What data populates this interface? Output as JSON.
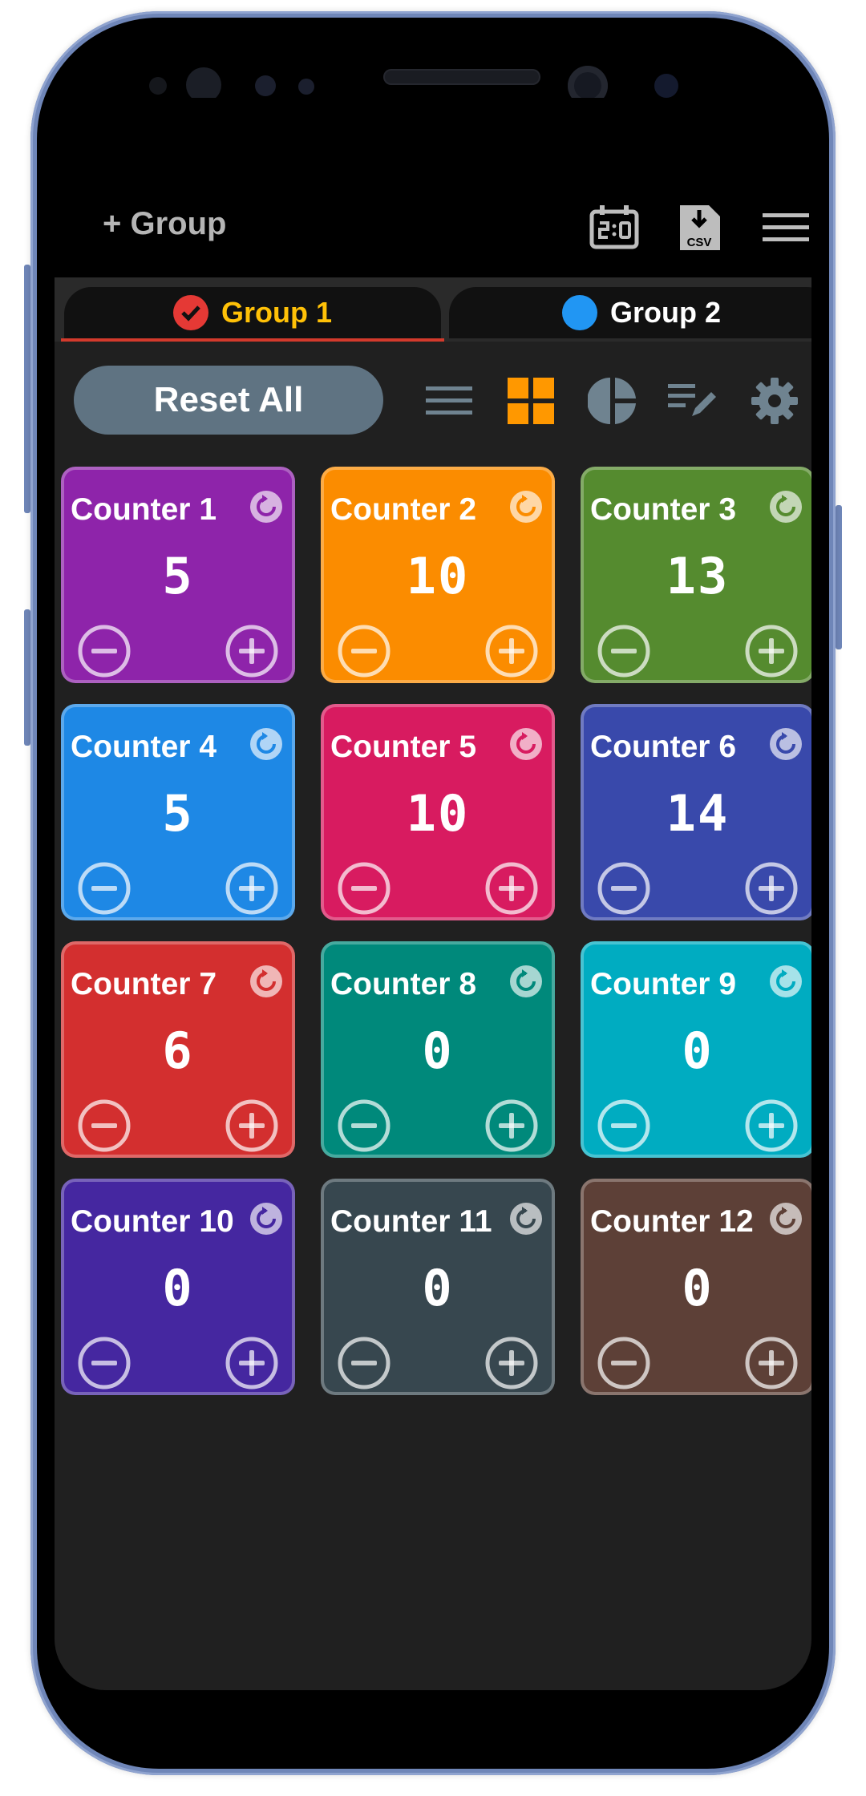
{
  "appbar": {
    "add_group_label": "+ Group",
    "icons": [
      "scoreboard-icon",
      "export-csv-icon",
      "menu-icon"
    ],
    "csv_text": "CSV"
  },
  "tabs": [
    {
      "label": "Group 1",
      "selected": true,
      "dot_color": "#e53935",
      "text_color": "#ffc107"
    },
    {
      "label": "Group 2",
      "selected": false,
      "dot_color": "#2196f3",
      "text_color": "#ffffff"
    }
  ],
  "toolbar": {
    "reset_all_label": "Reset All",
    "icons": [
      "list-view-icon",
      "grid-view-icon",
      "pie-chart-icon",
      "edit-list-icon",
      "settings-icon"
    ],
    "active_icon": "grid-view-icon",
    "accent_color": "#ff9800"
  },
  "counters": [
    {
      "name": "Counter 1",
      "value": "5",
      "color": "#8e24aa"
    },
    {
      "name": "Counter 2",
      "value": "10",
      "color": "#fb8c00"
    },
    {
      "name": "Counter 3",
      "value": "13",
      "color": "#558b2f"
    },
    {
      "name": "Counter 4",
      "value": "5",
      "color": "#1e88e5"
    },
    {
      "name": "Counter 5",
      "value": "10",
      "color": "#d81b60"
    },
    {
      "name": "Counter 6",
      "value": "14",
      "color": "#3949ab"
    },
    {
      "name": "Counter 7",
      "value": "6",
      "color": "#d32f2f"
    },
    {
      "name": "Counter 8",
      "value": "0",
      "color": "#00897b"
    },
    {
      "name": "Counter 9",
      "value": "0",
      "color": "#00acc1"
    },
    {
      "name": "Counter 10",
      "value": "0",
      "color": "#4527a0"
    },
    {
      "name": "Counter 11",
      "value": "0",
      "color": "#37474f"
    },
    {
      "name": "Counter 12",
      "value": "0",
      "color": "#5d4037"
    }
  ]
}
